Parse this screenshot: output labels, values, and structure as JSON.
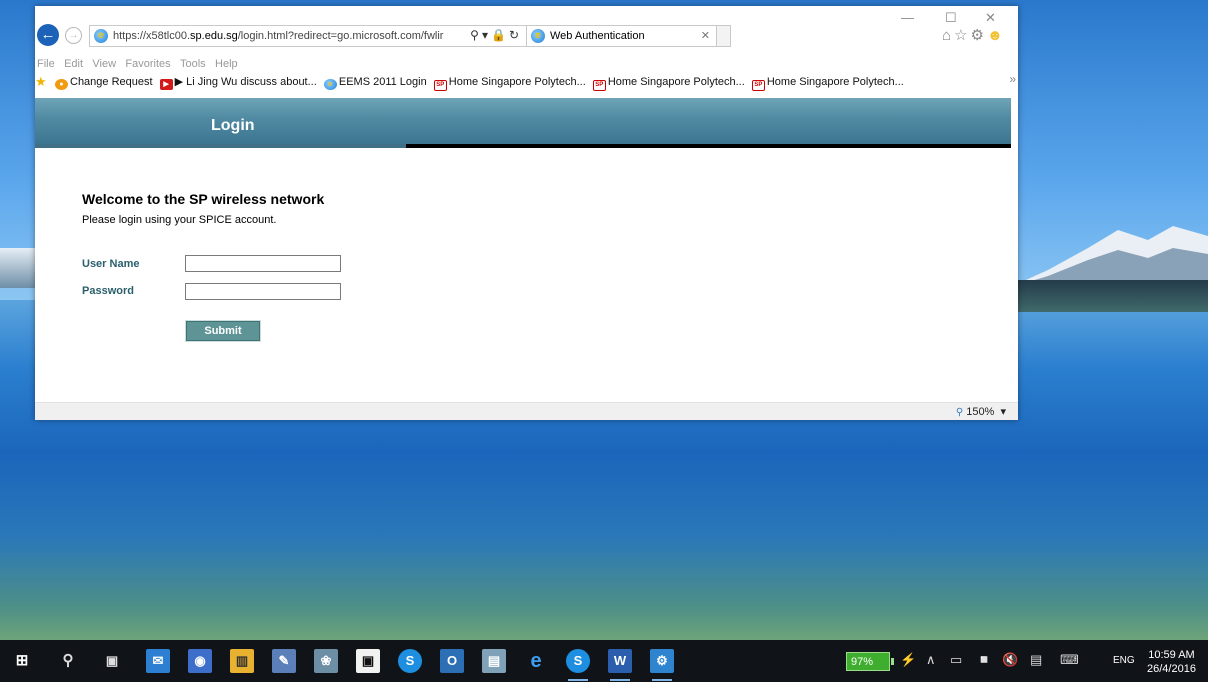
{
  "browser": {
    "url_prefix": "https://x58tlc00.",
    "url_domain": "sp.edu.sg",
    "url_suffix": "/login.html?redirect=go.microsoft.com/fwlir",
    "tab_title": "Web Authentication",
    "menu": [
      "File",
      "Edit",
      "View",
      "Favorites",
      "Tools",
      "Help"
    ],
    "favorites": [
      {
        "label": "Change Request",
        "icon": "orange-badge-icon"
      },
      {
        "label": "▶ Li Jing Wu discuss about...",
        "icon": "youtube-icon"
      },
      {
        "label": "EEMS 2011 Login",
        "icon": "ie-icon"
      },
      {
        "label": "Home  Singapore Polytech...",
        "icon": "sp-icon"
      },
      {
        "label": "Home  Singapore Polytech...",
        "icon": "sp-icon"
      },
      {
        "label": "Home  Singapore Polytech...",
        "icon": "sp-icon"
      }
    ],
    "zoom": "150%"
  },
  "page": {
    "header_title": "Login",
    "welcome": "Welcome to the SP wireless network",
    "subtitle": "Please login using your SPICE account.",
    "username_label": "User Name",
    "password_label": "Password",
    "username_value": "",
    "password_value": "",
    "submit_label": "Submit",
    "header_color": "#4f8aa2",
    "label_color": "#2a5f6b"
  },
  "taskbar": {
    "battery": "97%",
    "language": "ENG",
    "time": "10:59 AM",
    "date": "26/4/2016",
    "apps": [
      "outlook-icon",
      "photos-icon",
      "file-explorer-icon",
      "onenote-icon",
      "paint-icon",
      "store-icon",
      "skype-icon",
      "onenote-app-icon",
      "notepad-icon",
      "internet-explorer-icon",
      "skype-business-icon",
      "word-icon",
      "settings-icon"
    ]
  }
}
